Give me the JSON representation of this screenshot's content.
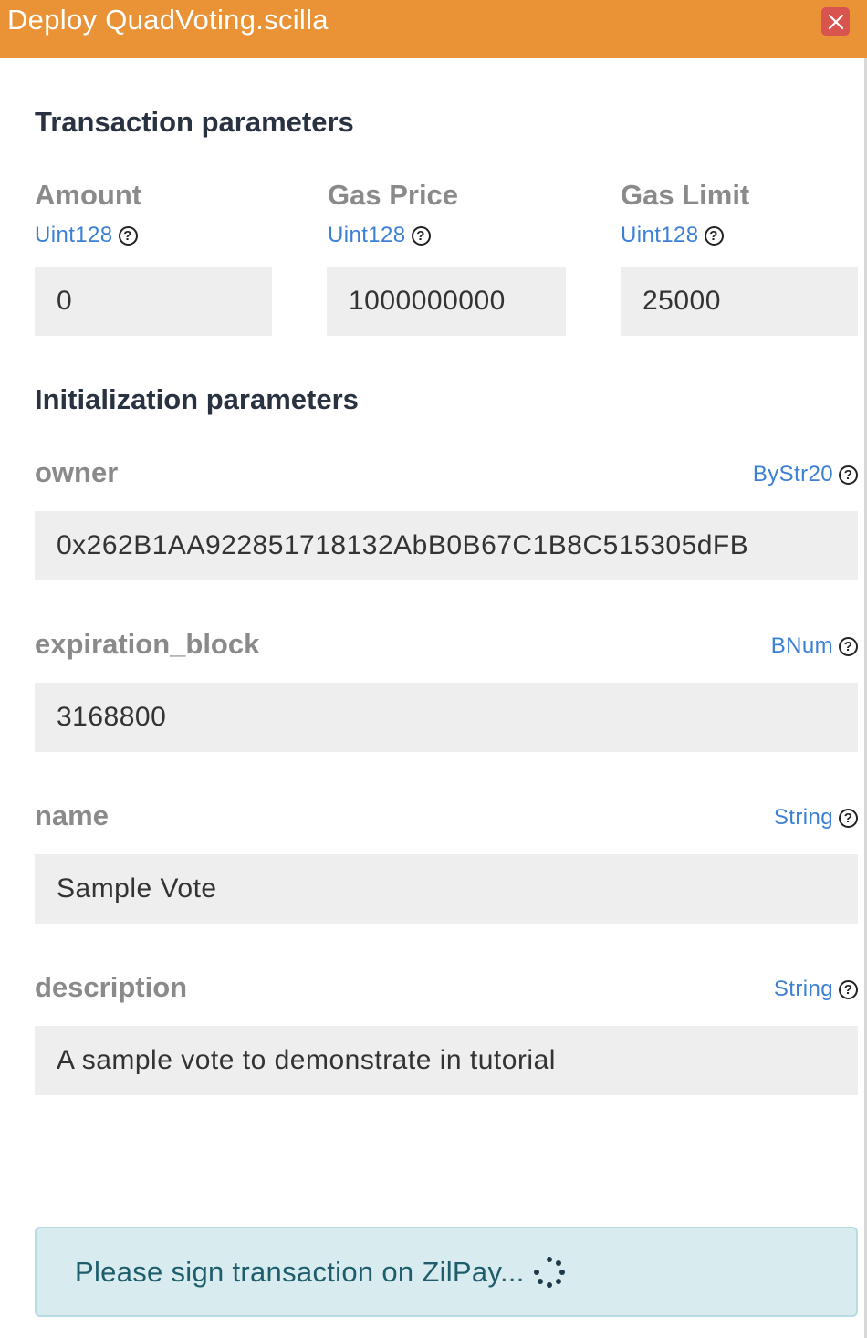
{
  "window": {
    "title": "Deploy QuadVoting.scilla"
  },
  "transaction": {
    "heading": "Transaction parameters",
    "fields": [
      {
        "label": "Amount",
        "type": "Uint128",
        "value": "0"
      },
      {
        "label": "Gas Price",
        "type": "Uint128",
        "value": "1000000000"
      },
      {
        "label": "Gas Limit",
        "type": "Uint128",
        "value": "25000"
      }
    ]
  },
  "init": {
    "heading": "Initialization parameters",
    "fields": [
      {
        "label": "owner",
        "type": "ByStr20",
        "value": "0x262B1AA922851718132AbB0B67C1B8C515305dFB"
      },
      {
        "label": "expiration_block",
        "type": "BNum",
        "value": "3168800"
      },
      {
        "label": "name",
        "type": "String",
        "value": "Sample Vote"
      },
      {
        "label": "description",
        "type": "String",
        "value": "A sample vote to demonstrate in tutorial"
      }
    ]
  },
  "help_glyph": "?",
  "status": {
    "message": "Please sign transaction on ZilPay..."
  },
  "colors": {
    "titlebar": "#e99336",
    "close": "#d9534f",
    "type_link": "#3c80d6",
    "status_bg": "#d8ecf0"
  }
}
